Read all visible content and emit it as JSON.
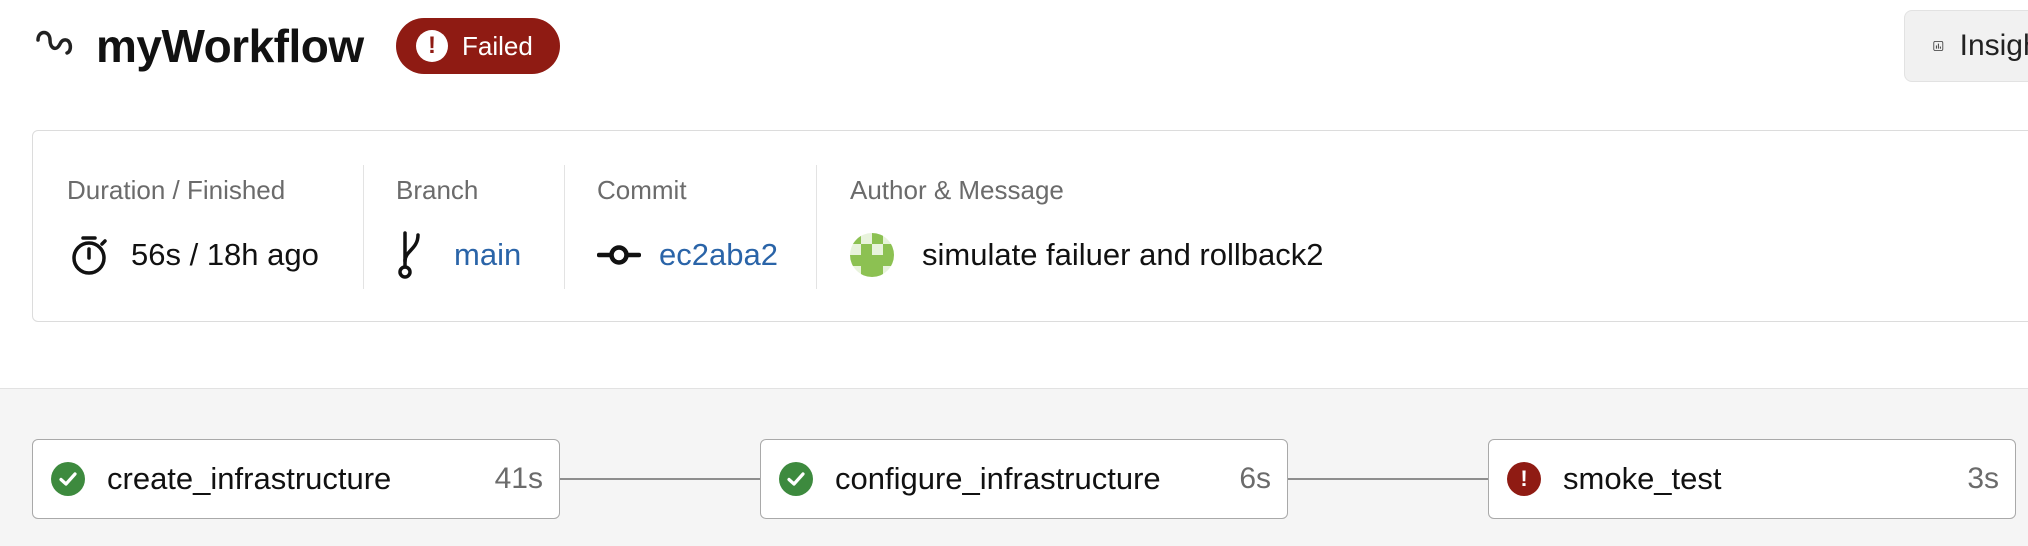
{
  "header": {
    "title": "myWorkflow",
    "status": "Failed",
    "insights_label": "Insights",
    "icons": {
      "workflow": "workflow-squiggle-icon",
      "status": "exclamation-icon",
      "insights": "bar-chart-icon"
    }
  },
  "summary": {
    "duration": {
      "label": "Duration / Finished",
      "value": "56s / 18h ago",
      "icon": "stopwatch-icon"
    },
    "branch": {
      "label": "Branch",
      "value": "main",
      "icon": "git-branch-icon"
    },
    "commit": {
      "label": "Commit",
      "value": "ec2aba2",
      "icon": "git-commit-icon"
    },
    "author": {
      "label": "Author & Message",
      "message": "simulate failuer and rollback2",
      "icon": "avatar"
    }
  },
  "pipeline": {
    "jobs": [
      {
        "name": "create_infrastructure",
        "duration": "41s",
        "status": "success"
      },
      {
        "name": "configure_infrastructure",
        "duration": "6s",
        "status": "success"
      },
      {
        "name": "smoke_test",
        "duration": "3s",
        "status": "failed"
      }
    ]
  },
  "colors": {
    "failed": "#8f1b13",
    "success": "#3d8a3e",
    "link": "#2a64a8",
    "avatar_green": "#8cc152"
  }
}
